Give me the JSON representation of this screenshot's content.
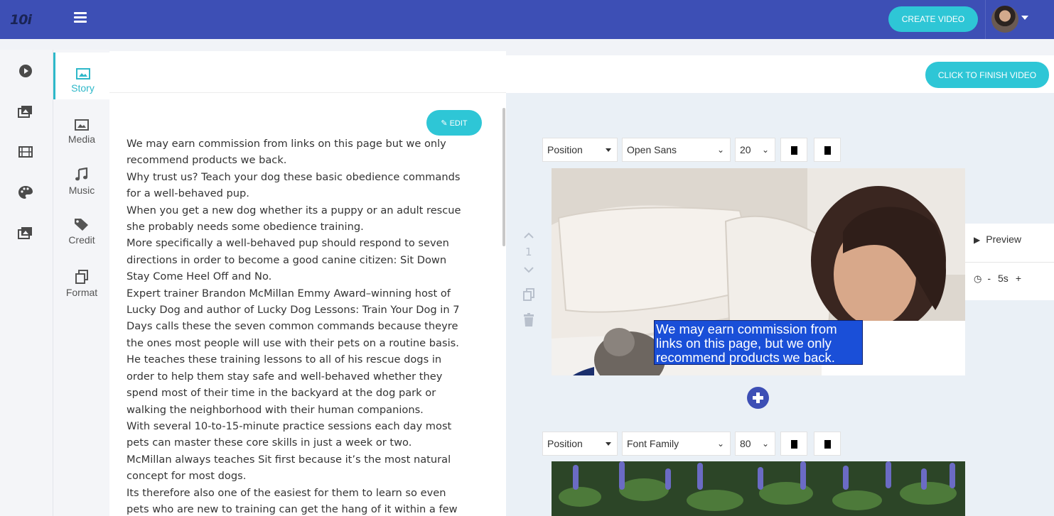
{
  "header": {
    "logo": "10i",
    "create_video_label": "CREATE VIDEO",
    "menu_icon": "hamburger-icon",
    "avatar_icon": "user-avatar"
  },
  "rail": {
    "icons": [
      "play-circle-icon",
      "gallery-icon",
      "film-icon",
      "palette-icon",
      "gallery-icon"
    ]
  },
  "tabs": [
    {
      "label": "Story",
      "icon": "image-icon",
      "active": true
    },
    {
      "label": "Media",
      "icon": "image-icon",
      "active": false
    },
    {
      "label": "Music",
      "icon": "music-icon",
      "active": false
    },
    {
      "label": "Credit",
      "icon": "tags-icon",
      "active": false
    },
    {
      "label": "Format",
      "icon": "copy-icon",
      "active": false
    }
  ],
  "story": {
    "edit_label": "EDIT",
    "lines": [
      "We may earn commission from links on this page but we only",
      "recommend products we back.",
      "Why trust us? Teach your dog these basic obedience commands",
      "for a well-behaved pup.",
      "When you get a new dog whether its a puppy or an adult rescue",
      "she probably needs some obedience training.",
      "More specifically a well-behaved pup should respond to seven",
      "directions in order to become a good canine citizen: Sit Down",
      "Stay Come Heel Off and No.",
      "Expert trainer Brandon McMillan Emmy Award–winning host of",
      "Lucky Dog and author of Lucky Dog Lessons: Train Your Dog in 7",
      "Days calls these the seven common commands because theyre",
      "the ones most people will use with their pets on a routine basis.",
      "He teaches these training lessons to all of his rescue dogs in",
      "order to help them stay safe and well-behaved whether they",
      "spend most of their time in the backyard at the dog park or",
      "walking the neighborhood with their human companions.",
      "With several 10-to-15-minute practice sessions each day most",
      "pets can master these core skills in just a week or two.",
      "McMillan always teaches Sit first because it’s the most natural",
      "concept for most dogs.",
      "Its therefore also one of the easiest for them to learn so even",
      "pets who are new to training can get the hang of it within a few"
    ]
  },
  "editor": {
    "finish_label": "CLICK TO FINISH VIDEO",
    "scenes": [
      {
        "position": "Position",
        "font": "Open Sans",
        "size": "20",
        "caption": [
          "We may earn commission from",
          "links on this page, but we only",
          "recommend products we back."
        ],
        "number": "1",
        "preview_label": "Preview",
        "duration": "5s",
        "minus": "-",
        "plus": "+"
      },
      {
        "position": "Position",
        "font": "Font Family",
        "size": "80"
      }
    ]
  }
}
